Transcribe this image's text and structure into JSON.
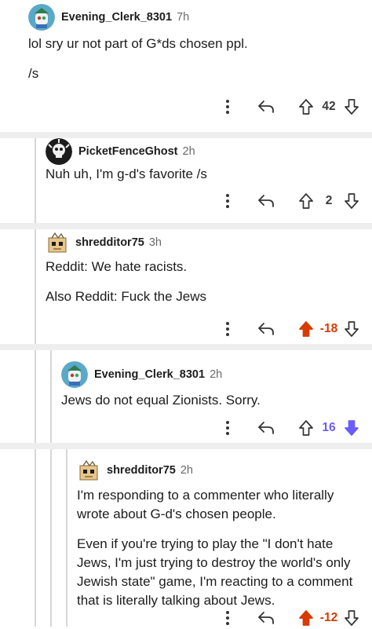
{
  "comments": [
    {
      "author": "Evening_Clerk_8301",
      "age": "7h",
      "paragraphs": [
        "lol sry ur not part of G*ds chosen ppl.",
        "/s"
      ],
      "score": "42",
      "vote": "none",
      "avatar": "robot-avatar"
    },
    {
      "author": "PicketFenceGhost",
      "age": "2h",
      "paragraphs": [
        "Nuh uh, I'm g-d's favorite /s"
      ],
      "score": "2",
      "vote": "none",
      "avatar": "skull-avatar"
    },
    {
      "author": "shredditor75",
      "age": "3h",
      "paragraphs": [
        "Reddit: We hate racists.",
        "Also Reddit: Fuck the Jews"
      ],
      "score": "-18",
      "vote": "up",
      "avatar": "box-avatar"
    },
    {
      "author": "Evening_Clerk_8301",
      "age": "2h",
      "paragraphs": [
        "Jews do not equal Zionists. Sorry."
      ],
      "score": "16",
      "vote": "down",
      "avatar": "robot-avatar"
    },
    {
      "author": "shredditor75",
      "age": "2h",
      "paragraphs": [
        "I'm responding to a commenter who literally wrote about G-d's chosen people.",
        "Even if you're trying to play the \"I don't hate Jews, I'm just trying to destroy the world's only Jewish state\" game, I'm reacting to a comment that is literally talking about Jews."
      ],
      "score": "-12",
      "vote": "up",
      "avatar": "box-avatar"
    }
  ],
  "colors": {
    "upvote": "#d93a00",
    "downvote": "#6a5cff",
    "thread_line": "#d7d7d7",
    "separator": "#eeeeee"
  },
  "icons": [
    "more-dots-icon",
    "reply-arrow-icon",
    "upvote-arrow-icon",
    "downvote-arrow-icon"
  ]
}
